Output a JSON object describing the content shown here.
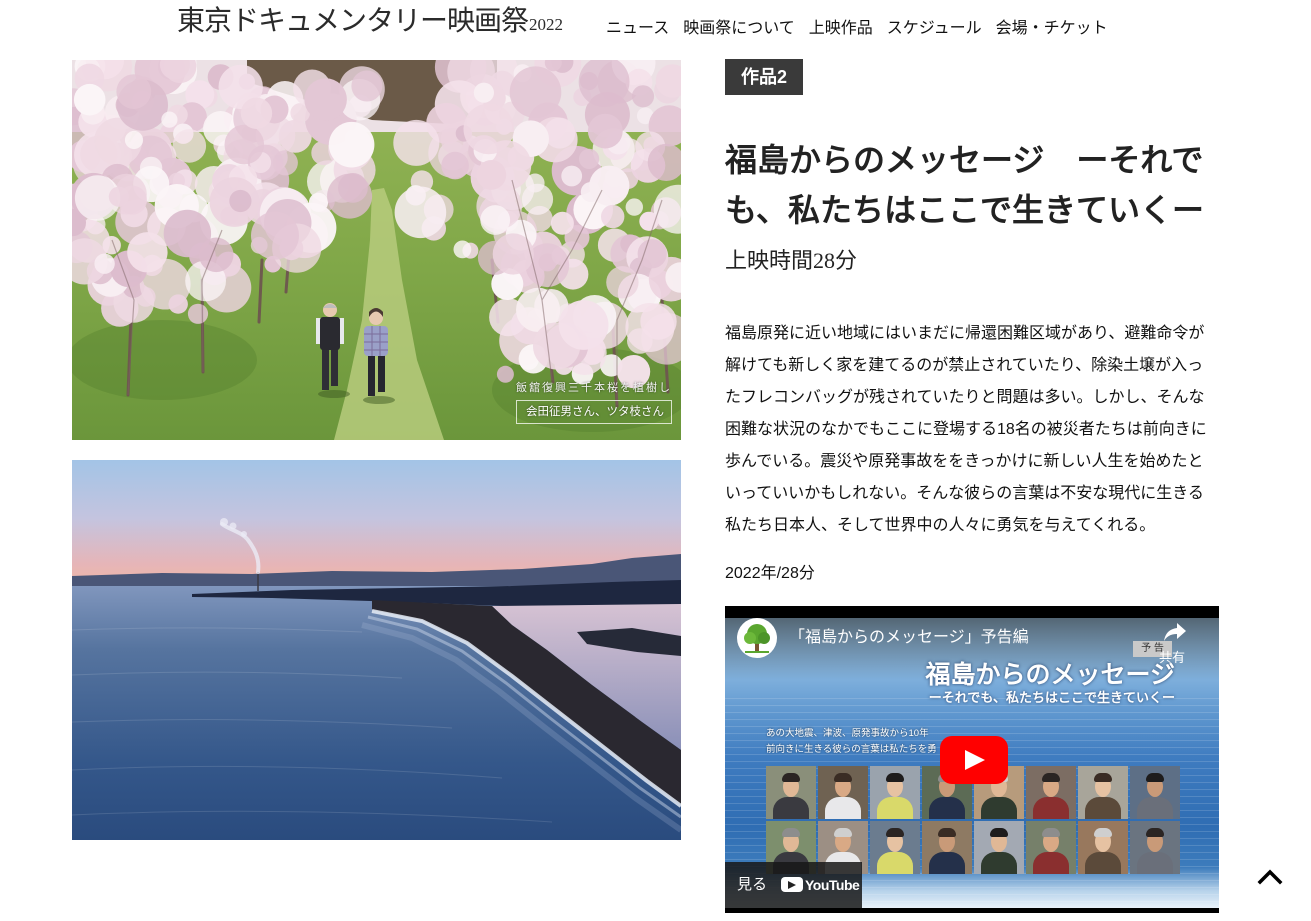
{
  "site": {
    "logo_text": "東京ドキュメンタリー映画祭",
    "logo_year": "2022"
  },
  "nav": [
    {
      "label": "ニュース"
    },
    {
      "label": "映画祭について"
    },
    {
      "label": "上映作品"
    },
    {
      "label": "スケジュール"
    },
    {
      "label": "会場・チケット"
    }
  ],
  "photos": {
    "first": {
      "caption_line1": "飯舘復興三千本桜を植樹し",
      "caption_line2": "会田征男さん、ツタ枝さん"
    }
  },
  "work": {
    "badge": "作品2",
    "title_lines": [
      "福島からのメッセージ　ーそれで",
      "も、私たちはここで生きていくー"
    ],
    "runtime": "上映時間28分",
    "description_lines": [
      "福島原発に近い地域にはいまだに帰還困難区域があり、避難命令が",
      "解けても新しく家を建てるのが禁止されていたり、除染土壌が入っ",
      "たフレコンバッグが残されていたりと問題は多い。しかし、そんな",
      "困難な状況のなかでもここに登場する18名の被災者たちは前向きに",
      "歩んでいる。震災や原発事故ををきっかけに新しい人生を始めたと",
      "いっていいかもしれない。そんな彼らの言葉は不安な現代に生きる",
      "私たち日本人、そして世界中の人々に勇気を与えてくれる。"
    ],
    "meta": "2022年/28分"
  },
  "video": {
    "title": "「福島からのメッセージ」予告編",
    "share_label": "共有",
    "thumbnail": {
      "tag": "予 告",
      "headline": "福島からのメッセージ",
      "subheadline": "ーそれでも、私たちはここで生きていくー",
      "text_lines": [
        "あの大地震、津波、原発事故から10年",
        "前向きに生きる彼らの言葉は私たちを勇"
      ]
    },
    "watch_label": "見る",
    "platform_label": "YouTube"
  },
  "icons": {
    "channel_avatar": "tree-icon",
    "share": "share-arrow-icon",
    "play": "play-button-icon",
    "youtube": "youtube-logo-icon",
    "back_to_top": "chevron-up-icon"
  },
  "colors": {
    "text": "#222222",
    "badge_background": "#3a3a3a",
    "badge_text": "#ffffff",
    "youtube_red": "#ff0000",
    "player_background": "#000000"
  }
}
